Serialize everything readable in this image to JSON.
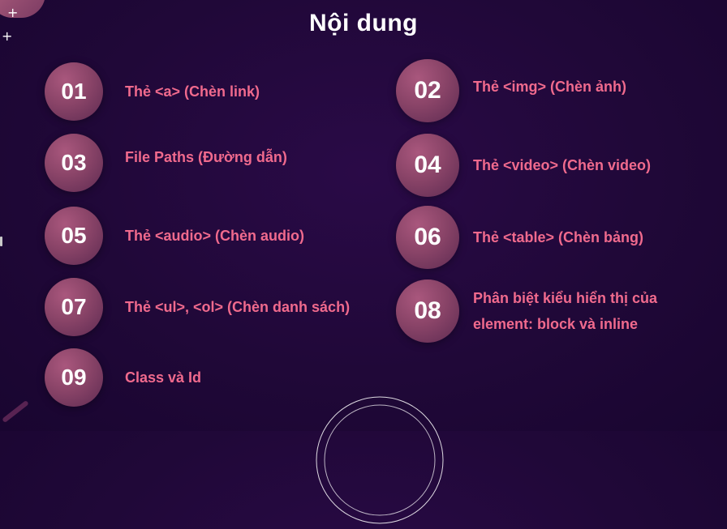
{
  "slide": {
    "title": "Nội dung"
  },
  "items": [
    {
      "number": "01",
      "label": "Thẻ <a>  (Chèn link)"
    },
    {
      "number": "02",
      "label": "Thẻ <img> (Chèn ảnh)"
    },
    {
      "number": "03",
      "label": "File Paths (Đường dẫn)"
    },
    {
      "number": "04",
      "label": "Thẻ <video> (Chèn video)"
    },
    {
      "number": "05",
      "label": "Thẻ <audio> (Chèn audio)"
    },
    {
      "number": "06",
      "label": "Thẻ <table> (Chèn bảng)"
    },
    {
      "number": "07",
      "label": "Thẻ <ul>, <ol> (Chèn danh sách)"
    },
    {
      "number": "08",
      "label": "Phân biệt kiểu hiển thị của element: block và inline"
    },
    {
      "number": "09",
      "label": "Class và Id"
    }
  ],
  "colors": {
    "background": "#200838",
    "badge": "#8a4468",
    "label": "#f06a8d",
    "title": "#ffffff"
  },
  "icons": {
    "plus": "+"
  }
}
